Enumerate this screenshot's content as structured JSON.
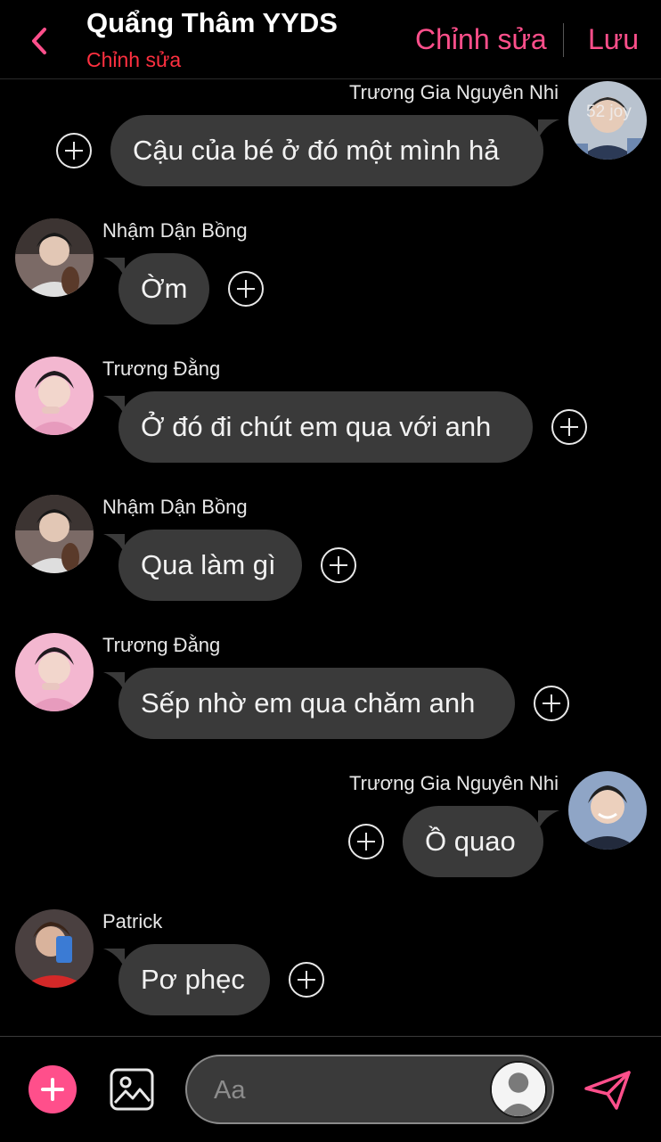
{
  "header": {
    "title": "Quẩng Thâm YYDS",
    "subtitle": "Chỉnh sửa",
    "edit_label": "Chỉnh sửa",
    "save_label": "Lưu",
    "accent_color": "#ff4f8b",
    "subtitle_color": "#ff3040"
  },
  "messages": [
    {
      "sender": "Trương Gia Nguyên Nhi",
      "text": "Cậu của bé ở đó một mình hả",
      "side": "right",
      "avatar_watermark": "52 joy"
    },
    {
      "sender": "Nhậm Dận Bồng",
      "text": "Ờm",
      "side": "left"
    },
    {
      "sender": "Trương Đằng",
      "text": "Ở đó đi chút em qua với anh",
      "side": "left"
    },
    {
      "sender": "Nhậm Dận Bồng",
      "text": "Qua làm gì",
      "side": "left"
    },
    {
      "sender": "Trương Đằng",
      "text": "Sếp nhờ em qua chăm anh",
      "side": "left"
    },
    {
      "sender": "Trương Gia Nguyên Nhi",
      "text": "Ồ quao",
      "side": "right"
    },
    {
      "sender": "Patrick",
      "text": "Pơ phẹc",
      "side": "left"
    }
  ],
  "composer": {
    "placeholder": "Aa"
  },
  "icons": {
    "back": "chevron-left-icon",
    "add": "plus-icon",
    "image": "image-icon",
    "send": "send-icon",
    "react": "plus-circle-icon"
  },
  "colors": {
    "background": "#000000",
    "bubble": "#3a3a3a",
    "accent": "#ff4f8b"
  }
}
